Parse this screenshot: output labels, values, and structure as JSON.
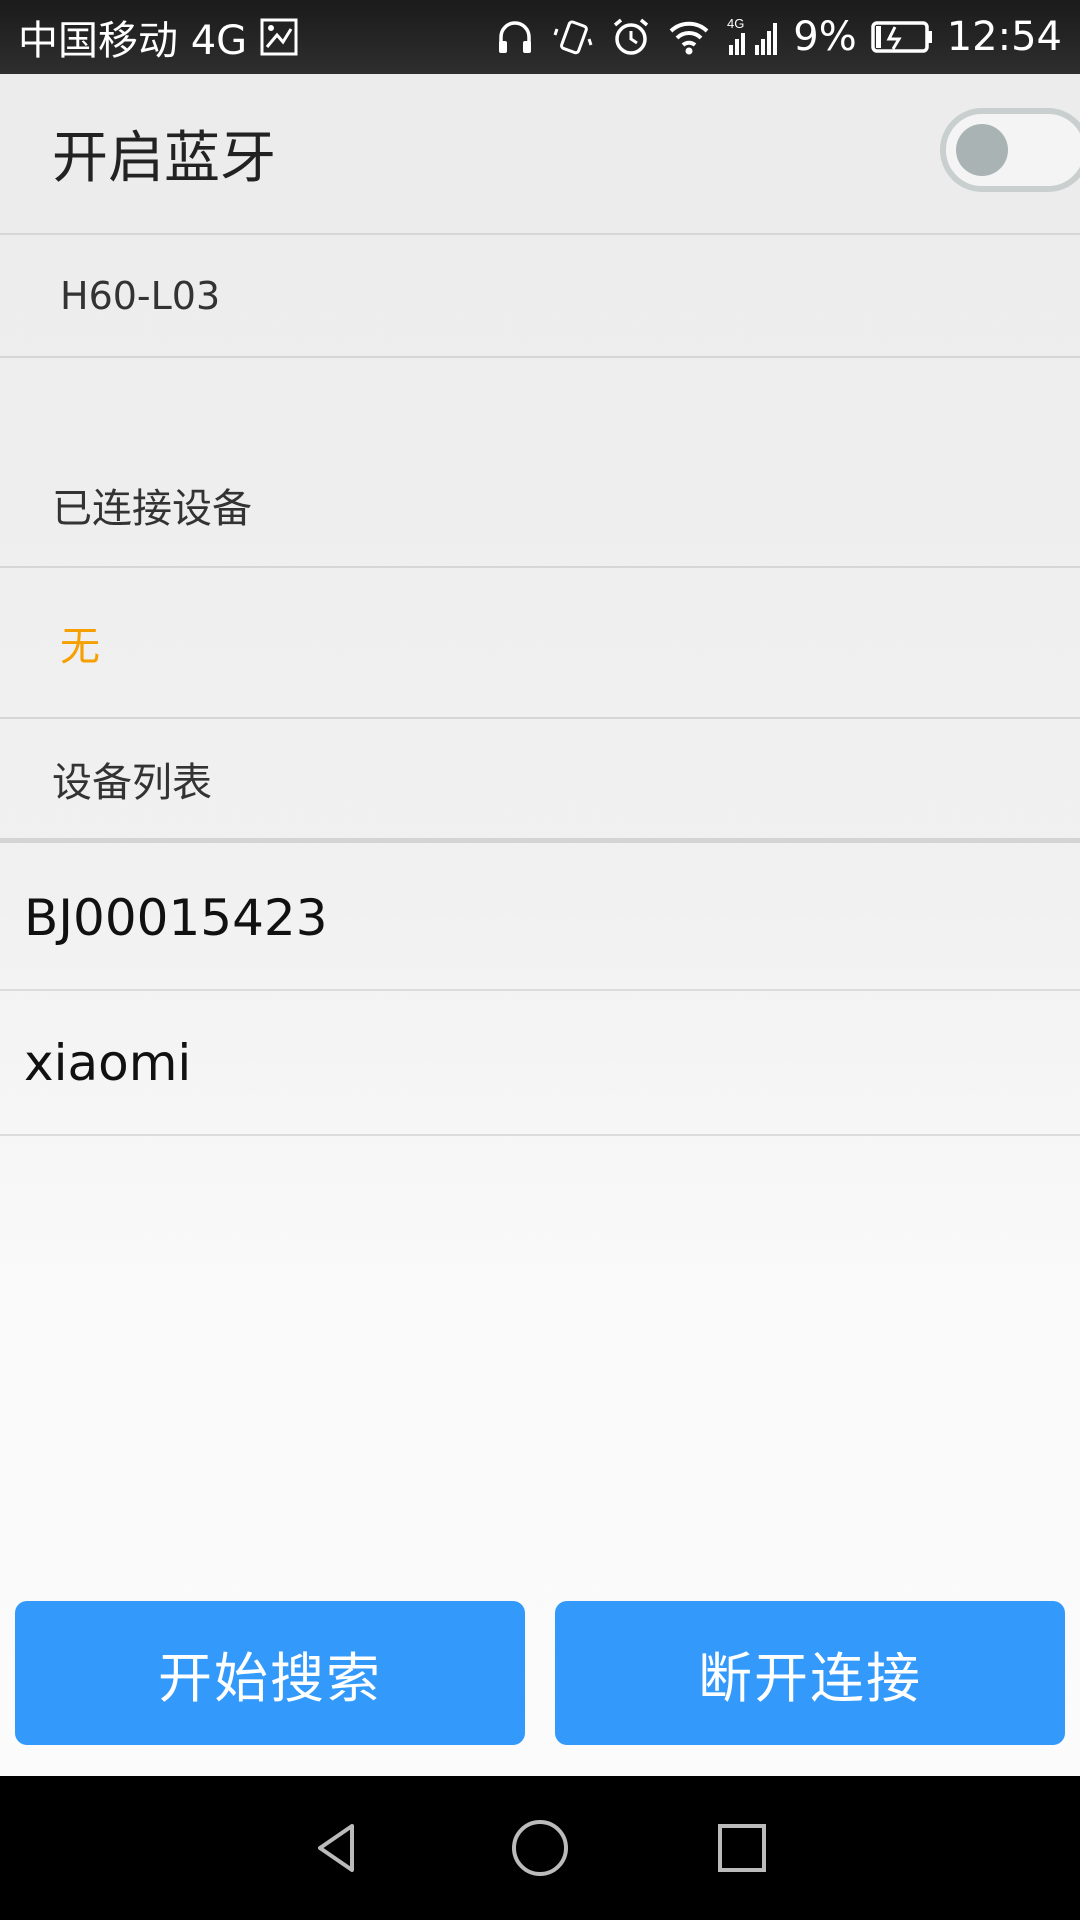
{
  "status_bar": {
    "carrier": "中国移动 4G",
    "signal_tag": "4G",
    "battery": "9%",
    "time": "12:54"
  },
  "bluetooth": {
    "toggle_label": "开启蓝牙",
    "enabled": false,
    "device_name": "H60-L03"
  },
  "connected": {
    "header": "已连接设备",
    "value": "无",
    "value_color": "#f5a000"
  },
  "device_list": {
    "header": "设备列表",
    "items": [
      {
        "name": "BJ00015423"
      },
      {
        "name": "xiaomi"
      }
    ]
  },
  "actions": {
    "search_label": "开始搜索",
    "disconnect_label": "断开连接",
    "accent_color": "#3399fb"
  },
  "nav": {
    "icons": [
      "back-icon",
      "home-icon",
      "recents-icon"
    ]
  }
}
